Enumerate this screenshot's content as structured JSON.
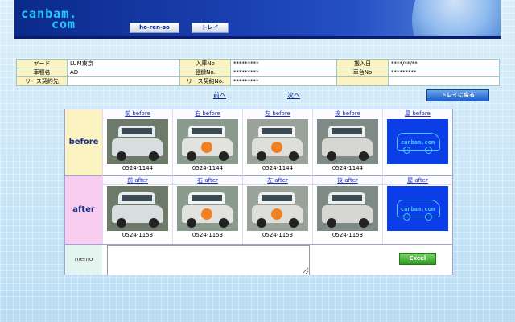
{
  "header": {
    "logo_line1": "canbam.",
    "logo_line2": "com",
    "tabs": [
      "ho-ren-so",
      "トレイ"
    ]
  },
  "info": {
    "rows": [
      [
        {
          "label": "ヤード",
          "value": "LUM東京"
        },
        {
          "label": "入庫No",
          "value": "*********"
        },
        {
          "label": "搬入日",
          "value": "****/**/**"
        }
      ],
      [
        {
          "label": "車種名",
          "value": "AD"
        },
        {
          "label": "登録No.",
          "value": "*********"
        },
        {
          "label": "車台No",
          "value": "*********"
        }
      ],
      [
        {
          "label": "リース契約先",
          "value": ""
        },
        {
          "label": "リース契約No.",
          "value": "*********"
        },
        {
          "label": "",
          "value": ""
        }
      ]
    ]
  },
  "nav": {
    "prev": "前へ",
    "next": "次へ",
    "back_to_tray": "トレイに戻る"
  },
  "photos": {
    "before_label": "before",
    "after_label": "after",
    "memo_label": "memo",
    "before": [
      {
        "caption": "前 before",
        "code": "0524-1144",
        "kind": "car"
      },
      {
        "caption": "右 before",
        "code": "0524-1144",
        "kind": "car"
      },
      {
        "caption": "左 before",
        "code": "0524-1144",
        "kind": "car"
      },
      {
        "caption": "後 before",
        "code": "0524-1144",
        "kind": "car"
      },
      {
        "caption": "屋 before",
        "code": "",
        "kind": "logo"
      }
    ],
    "after": [
      {
        "caption": "前 after",
        "code": "0524-1153",
        "kind": "car"
      },
      {
        "caption": "右 after",
        "code": "0524-1153",
        "kind": "car"
      },
      {
        "caption": "左 after",
        "code": "0524-1153",
        "kind": "car"
      },
      {
        "caption": "後 after",
        "code": "0524-1153",
        "kind": "car"
      },
      {
        "caption": "屋 after",
        "code": "",
        "kind": "logo"
      }
    ],
    "logo_text": "canbam.com",
    "excel_label": "Excel"
  },
  "colors": {
    "header": "#1a3fb0",
    "label_bg": "#fbf3c2",
    "after_bg": "#f8cdf0",
    "link": "#1a2fb8",
    "excel": "#2e9a22"
  }
}
